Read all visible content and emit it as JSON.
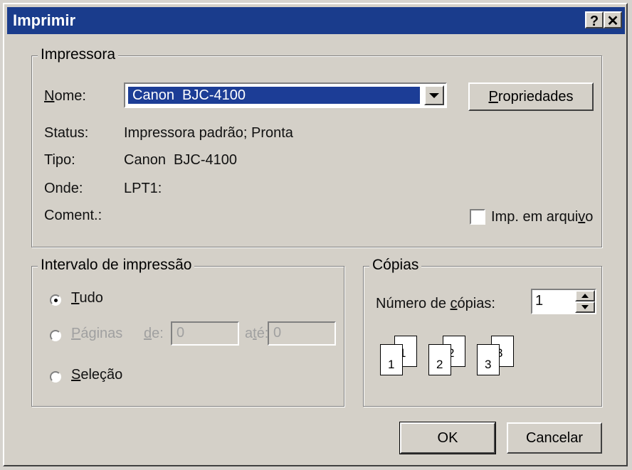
{
  "window": {
    "title": "Imprimir",
    "help_button": "?",
    "close_button": "✕"
  },
  "printer": {
    "legend": "Impressora",
    "name_label_acc": "N",
    "name_label_rest": "ome:",
    "name_value": "Canon  BJC-4100",
    "properties_button_acc": "P",
    "properties_button_rest": "ropriedades",
    "status_label": "Status:",
    "status_value": "Impressora padrão; Pronta",
    "type_label": "Tipo:",
    "type_value": "Canon  BJC-4100",
    "where_label": "Onde:",
    "where_value": "LPT1:",
    "comment_label": "Coment.:",
    "print_to_file_label_pre": "Imp. em arqui",
    "print_to_file_label_acc": "v",
    "print_to_file_label_post": "o",
    "print_to_file_checked": false
  },
  "range": {
    "legend": "Intervalo de impressão",
    "all_acc": "T",
    "all_rest": "udo",
    "all_selected": true,
    "pages_acc": "P",
    "pages_rest": "áginas",
    "from_acc": "d",
    "from_rest": "e:",
    "from_value": "0",
    "to_pre": "a",
    "to_acc": "t",
    "to_post": "é:",
    "to_value": "0",
    "selection_acc": "S",
    "selection_rest": "eleção"
  },
  "copies": {
    "legend": "Cópias",
    "count_label_pre": "Número de ",
    "count_label_acc": "c",
    "count_label_post": "ópias:",
    "count_value": "1",
    "collate_pages": [
      "1",
      "1",
      "2",
      "2",
      "3",
      "3"
    ]
  },
  "actions": {
    "ok_label": "OK",
    "cancel_label": "Cancelar"
  }
}
